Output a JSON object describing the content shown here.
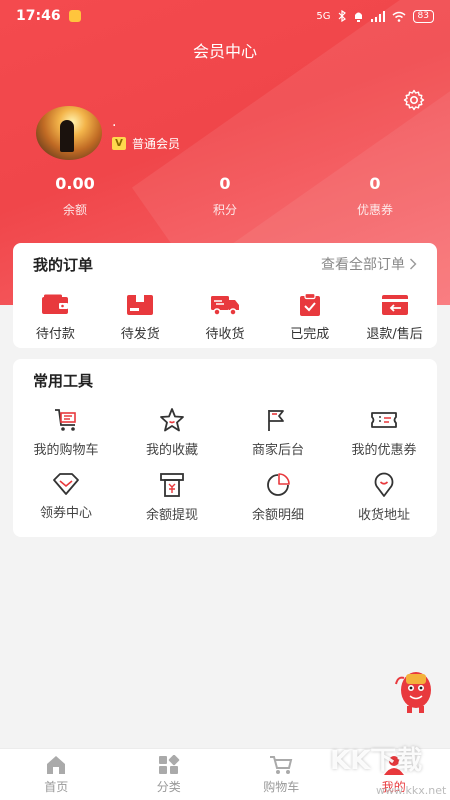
{
  "status_bar": {
    "time": "17:46",
    "network": "5G",
    "battery": "83"
  },
  "nav": {
    "title": "会员中心"
  },
  "profile": {
    "name": ".",
    "level": "普通会员",
    "badge": "V"
  },
  "stats": [
    {
      "value": "0.00",
      "label": "余额"
    },
    {
      "value": "0",
      "label": "积分"
    },
    {
      "value": "0",
      "label": "优惠券"
    }
  ],
  "orders": {
    "title": "我的订单",
    "view_all": "查看全部订单",
    "items": [
      {
        "label": "待付款",
        "icon": "wallet-icon"
      },
      {
        "label": "待发货",
        "icon": "package-icon"
      },
      {
        "label": "待收货",
        "icon": "truck-icon"
      },
      {
        "label": "已完成",
        "icon": "clipboard-check-icon"
      },
      {
        "label": "退款/售后",
        "icon": "refund-icon"
      }
    ]
  },
  "tools": {
    "title": "常用工具",
    "items": [
      {
        "label": "我的购物车",
        "icon": "cart-icon"
      },
      {
        "label": "我的收藏",
        "icon": "star-icon"
      },
      {
        "label": "商家后台",
        "icon": "flag-icon"
      },
      {
        "label": "我的优惠券",
        "icon": "ticket-icon"
      },
      {
        "label": "领券中心",
        "icon": "diamond-icon"
      },
      {
        "label": "余额提现",
        "icon": "withdraw-icon"
      },
      {
        "label": "余额明细",
        "icon": "pie-icon"
      },
      {
        "label": "收货地址",
        "icon": "location-icon"
      }
    ]
  },
  "tabs": [
    {
      "label": "首页",
      "icon": "home-icon"
    },
    {
      "label": "分类",
      "icon": "category-icon"
    },
    {
      "label": "购物车",
      "icon": "cart-icon"
    },
    {
      "label": "我的",
      "icon": "user-icon",
      "active": true
    }
  ],
  "watermark": {
    "text": "KK下载",
    "url": "www.kkx.net"
  },
  "colors": {
    "accent": "#e8393d",
    "header": "#f44a4e",
    "badge": "#ffd84d"
  }
}
